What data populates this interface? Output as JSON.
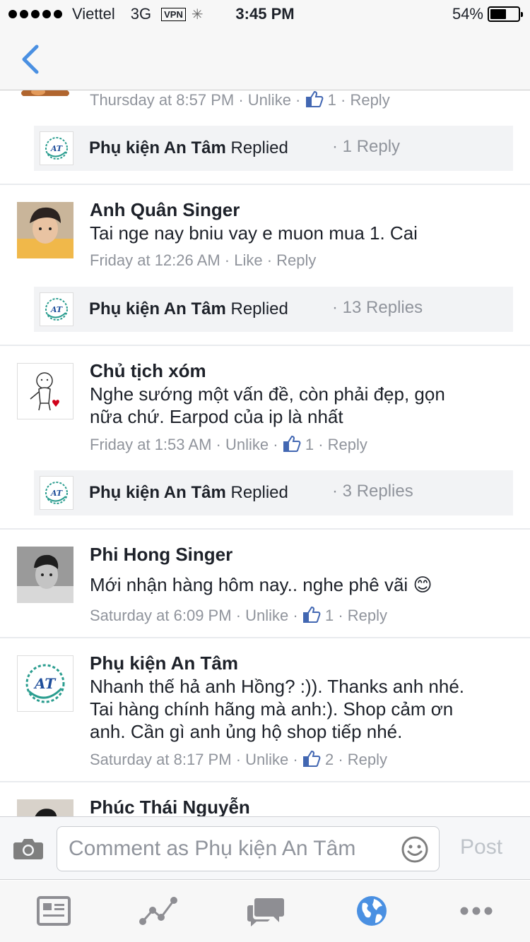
{
  "status_bar": {
    "carrier": "Viettel",
    "network": "3G",
    "vpn": "VPN",
    "time": "3:45 PM",
    "battery": "54%",
    "battery_level": 0.54
  },
  "colors": {
    "accent": "#4a90e2",
    "meta_gray": "#90949c",
    "like_blue": "#4267b2"
  },
  "comments": [
    {
      "meta": {
        "time": "Thursday at 8:57 PM",
        "action": "Unlike",
        "likes": "1",
        "reply": "Reply"
      },
      "reply_summary": {
        "name": "Phụ kiện An Tâm",
        "verb": "Replied",
        "count": "1 Reply"
      }
    },
    {
      "name": "Anh Quân Singer",
      "text": "Tai nge nay bniu vay e muon mua 1. Cai",
      "meta": {
        "time": "Friday at 12:26 AM",
        "action": "Like",
        "reply": "Reply"
      },
      "reply_summary": {
        "name": "Phụ kiện An Tâm",
        "verb": "Replied",
        "count": "13 Replies"
      }
    },
    {
      "name": "Chủ tịch xóm",
      "text_line1": "Nghe sướng một vấn đề, còn phải đẹp, gọn",
      "text_line2": "nữa chứ. Earpod của ip là nhất",
      "meta": {
        "time": "Friday at 1:53 AM",
        "action": "Unlike",
        "likes": "1",
        "reply": "Reply"
      },
      "reply_summary": {
        "name": "Phụ kiện An Tâm",
        "verb": "Replied",
        "count": "3 Replies"
      }
    },
    {
      "name": "Phi Hong Singer",
      "text": "Mới nhận hàng hôm nay.. nghe phê vãi",
      "emoji": "😊",
      "meta": {
        "time": "Saturday at 6:09 PM",
        "action": "Unlike",
        "likes": "1",
        "reply": "Reply"
      }
    },
    {
      "name": "Phụ kiện An Tâm",
      "text_line1": "Nhanh thế hả anh Hồng? :)). Thanks anh nhé.",
      "text_line2": "Tai hàng chính hãng mà anh:). Shop cảm ơn",
      "text_line3": "anh. Cần gì anh ủng hộ shop tiếp nhé.",
      "meta": {
        "time": "Saturday at 8:17 PM",
        "action": "Unlike",
        "likes": "2",
        "reply": "Reply"
      }
    },
    {
      "name": "Phúc Thái Nguyễn"
    }
  ],
  "comment_bar": {
    "placeholder": "Comment as Phụ kiện An Tâm",
    "post_label": "Post"
  },
  "tab_bar": {
    "icons": [
      "news-feed-icon",
      "insights-icon",
      "messages-icon",
      "notifications-globe-icon",
      "more-icon"
    ],
    "active": "notifications-globe-icon"
  }
}
